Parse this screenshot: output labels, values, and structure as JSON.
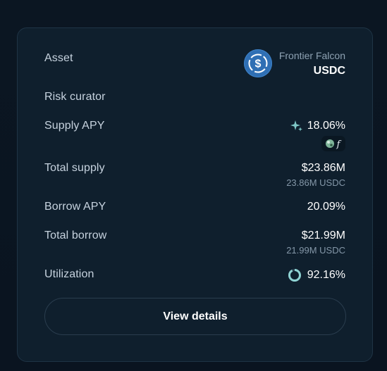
{
  "asset": {
    "label": "Asset",
    "vault_name": "Frontier Falcon",
    "symbol": "USDC",
    "icon": "usdc-coin-icon"
  },
  "risk_curator": {
    "label": "Risk curator"
  },
  "supply_apy": {
    "label": "Supply APY",
    "value": "18.06%",
    "icon": "sparkle-icon",
    "reward_icon": "reward-token-icon"
  },
  "total_supply": {
    "label": "Total supply",
    "value": "$23.86M",
    "sub": "23.86M USDC"
  },
  "borrow_apy": {
    "label": "Borrow APY",
    "value": "20.09%"
  },
  "total_borrow": {
    "label": "Total borrow",
    "value": "$21.99M",
    "sub": "21.99M USDC"
  },
  "utilization": {
    "label": "Utilization",
    "value": "92.16%",
    "fraction": 0.9216,
    "icon": "utilization-ring-icon"
  },
  "actions": {
    "view_details": "View details"
  },
  "colors": {
    "card_bg": "#0f1f2d",
    "accent_teal": "#6fc1c4",
    "usdc_blue": "#2f6fb4"
  }
}
